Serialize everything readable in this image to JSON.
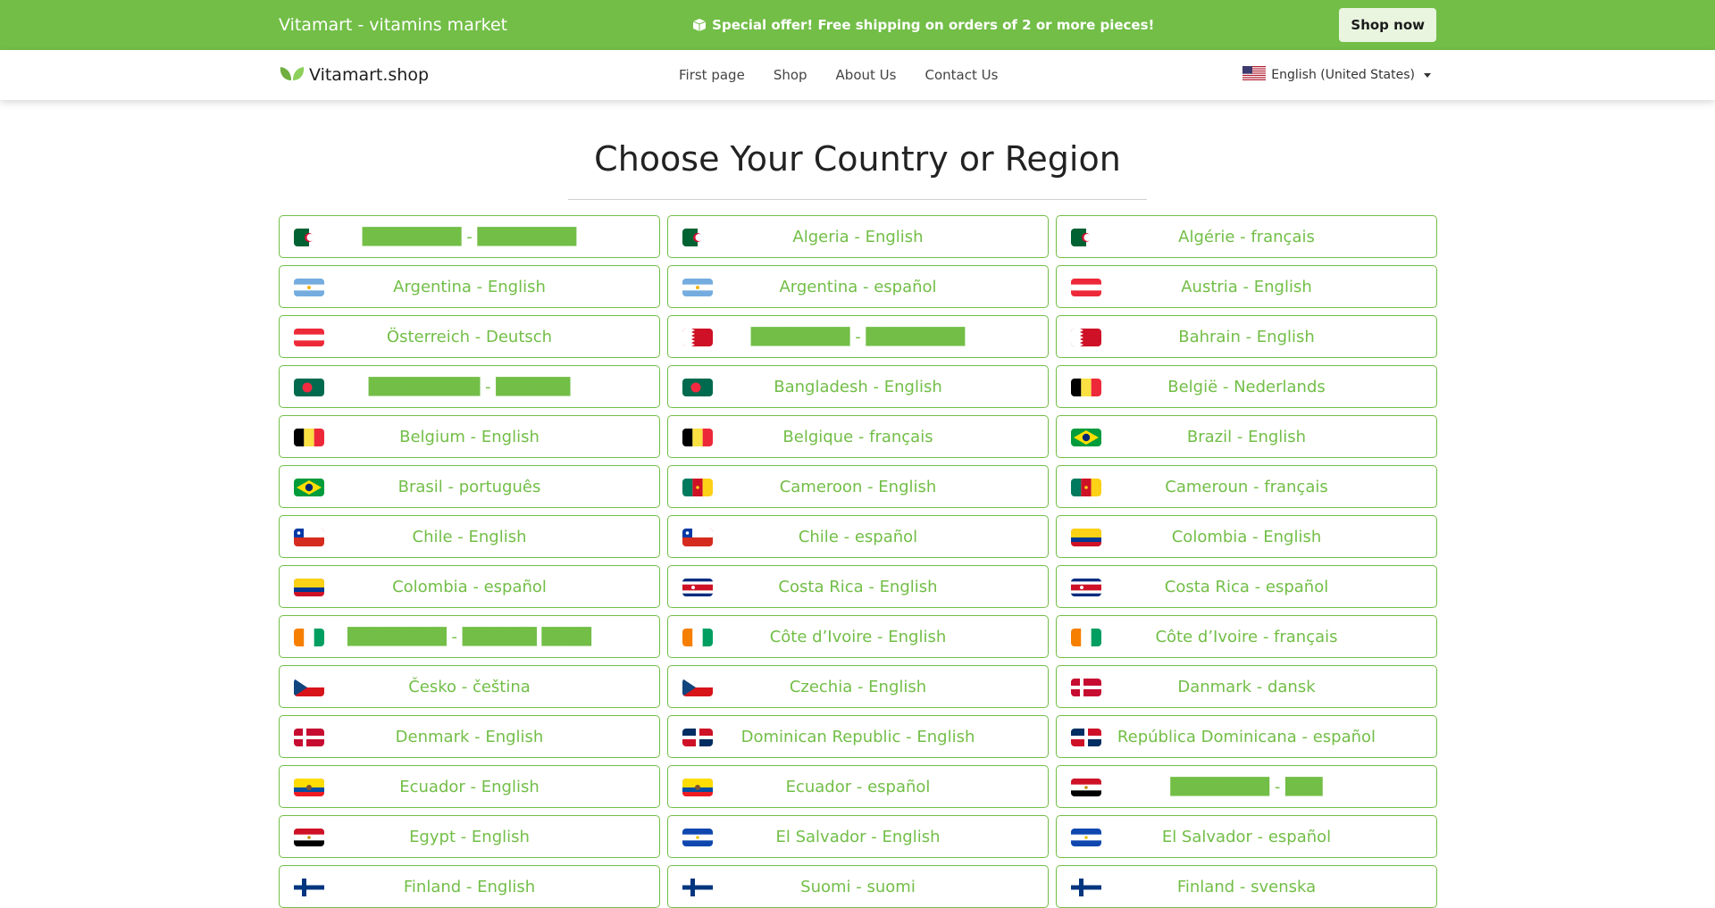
{
  "topbar": {
    "brand": "Vitamart - vitamins market",
    "offer": "Special offer! Free shipping on orders of 2 or more pieces!",
    "shop_now": "Shop now"
  },
  "nav": {
    "logo": "Vitamart.shop",
    "links": [
      "First page",
      "Shop",
      "About Us",
      "Contact Us"
    ],
    "language": "English (United States)"
  },
  "page": {
    "title": "Choose Your Country or Region"
  },
  "countries": [
    {
      "label": "████████ - ████████",
      "flag": "algeria"
    },
    {
      "label": "Algeria - English",
      "flag": "algeria"
    },
    {
      "label": "Algérie - français",
      "flag": "algeria"
    },
    {
      "label": "Argentina - English",
      "flag": "argentina"
    },
    {
      "label": "Argentina - español",
      "flag": "argentina"
    },
    {
      "label": "Austria - English",
      "flag": "austria"
    },
    {
      "label": "Österreich - Deutsch",
      "flag": "austria"
    },
    {
      "label": "████████ - ████████",
      "flag": "bahrain"
    },
    {
      "label": "Bahrain - English",
      "flag": "bahrain"
    },
    {
      "label": "█████████ - ██████",
      "flag": "bangladesh"
    },
    {
      "label": "Bangladesh - English",
      "flag": "bangladesh"
    },
    {
      "label": "België - Nederlands",
      "flag": "belgium"
    },
    {
      "label": "Belgium - English",
      "flag": "belgium"
    },
    {
      "label": "Belgique - français",
      "flag": "belgium"
    },
    {
      "label": "Brazil - English",
      "flag": "brazil"
    },
    {
      "label": "Brasil - português",
      "flag": "brazil"
    },
    {
      "label": "Cameroon - English",
      "flag": "cameroon"
    },
    {
      "label": "Cameroun - français",
      "flag": "cameroon"
    },
    {
      "label": "Chile - English",
      "flag": "chile"
    },
    {
      "label": "Chile - español",
      "flag": "chile"
    },
    {
      "label": "Colombia - English",
      "flag": "colombia"
    },
    {
      "label": "Colombia - español",
      "flag": "colombia"
    },
    {
      "label": "Costa Rica - English",
      "flag": "costa-rica"
    },
    {
      "label": "Costa Rica - español",
      "flag": "costa-rica"
    },
    {
      "label": "████████ - ██████ ████",
      "flag": "cote-divoire"
    },
    {
      "label": "Côte d’Ivoire - English",
      "flag": "cote-divoire"
    },
    {
      "label": "Côte d’Ivoire - français",
      "flag": "cote-divoire"
    },
    {
      "label": "Česko - čeština",
      "flag": "czechia"
    },
    {
      "label": "Czechia - English",
      "flag": "czechia"
    },
    {
      "label": "Danmark - dansk",
      "flag": "denmark"
    },
    {
      "label": "Denmark - English",
      "flag": "denmark"
    },
    {
      "label": "Dominican Republic - English",
      "flag": "dominican-republic"
    },
    {
      "label": "República Dominicana - español",
      "flag": "dominican-republic"
    },
    {
      "label": "Ecuador - English",
      "flag": "ecuador"
    },
    {
      "label": "Ecuador - español",
      "flag": "ecuador"
    },
    {
      "label": "████████ - ███",
      "flag": "egypt"
    },
    {
      "label": "Egypt - English",
      "flag": "egypt"
    },
    {
      "label": "El Salvador - English",
      "flag": "el-salvador"
    },
    {
      "label": "El Salvador - español",
      "flag": "el-salvador"
    },
    {
      "label": "Finland - English",
      "flag": "finland"
    },
    {
      "label": "Suomi - suomi",
      "flag": "finland"
    },
    {
      "label": "Finland - svenska",
      "flag": "finland"
    }
  ],
  "colors": {
    "accent": "#72be47",
    "shop_button_bg": "#e9f5df"
  }
}
